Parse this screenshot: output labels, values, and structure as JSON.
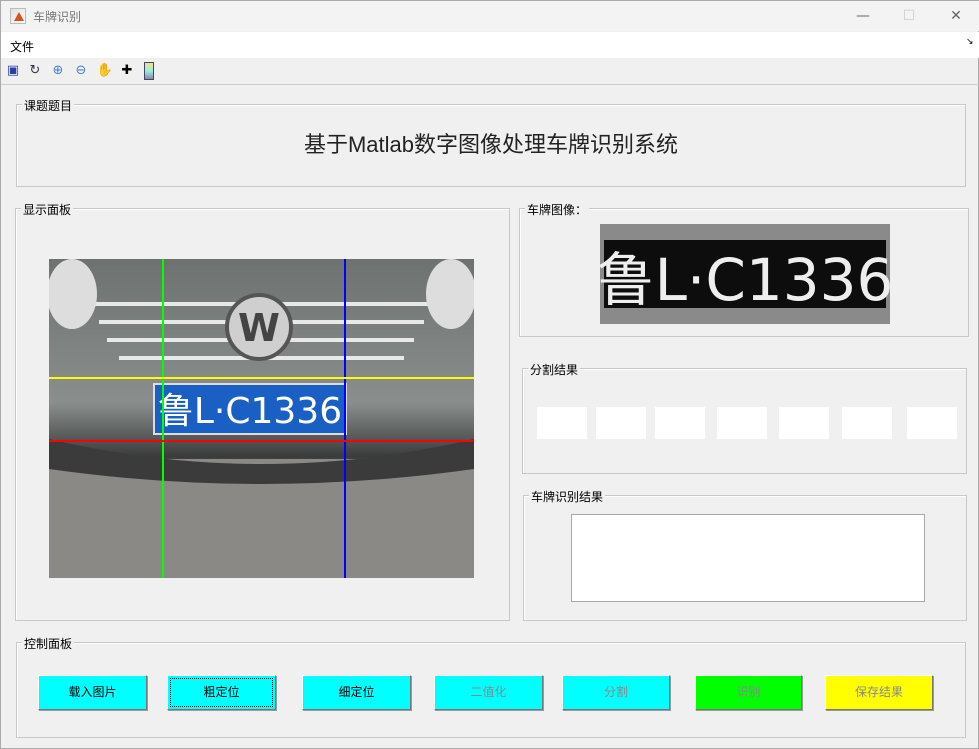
{
  "window": {
    "title": "车牌识别",
    "icon": "matlab-icon"
  },
  "menu": {
    "file": "文件"
  },
  "toolbar": [
    "save-icon",
    "rotate-icon",
    "zoom-in-icon",
    "zoom-out-icon",
    "pan-hand-icon",
    "data-cursor-icon",
    "colorbar-icon"
  ],
  "panels": {
    "topic": {
      "label": "课题题目",
      "title": "基于Matlab数字图像处理车牌识别系统"
    },
    "display": {
      "label": "显示面板"
    },
    "plate": {
      "label": "车牌图像：",
      "plate_text": "鲁L·C1336"
    },
    "segment": {
      "label": "分割结果"
    },
    "result": {
      "label": "车牌识别结果",
      "value": ""
    },
    "control": {
      "label": "控制面板"
    }
  },
  "car_plate_text": "鲁L·C1336",
  "buttons": [
    {
      "label": "载入图片",
      "color": "#00ffff",
      "enabled": true
    },
    {
      "label": "粗定位",
      "color": "#00ffff",
      "enabled": true,
      "focused": true
    },
    {
      "label": "细定位",
      "color": "#00ffff",
      "enabled": true
    },
    {
      "label": "二值化",
      "color": "#00ffff",
      "enabled": false
    },
    {
      "label": "分割",
      "color": "#00ffff",
      "enabled": false
    },
    {
      "label": "识别",
      "color": "#00ff00",
      "enabled": false
    },
    {
      "label": "保存结果",
      "color": "#ffff00",
      "enabled": false
    }
  ]
}
